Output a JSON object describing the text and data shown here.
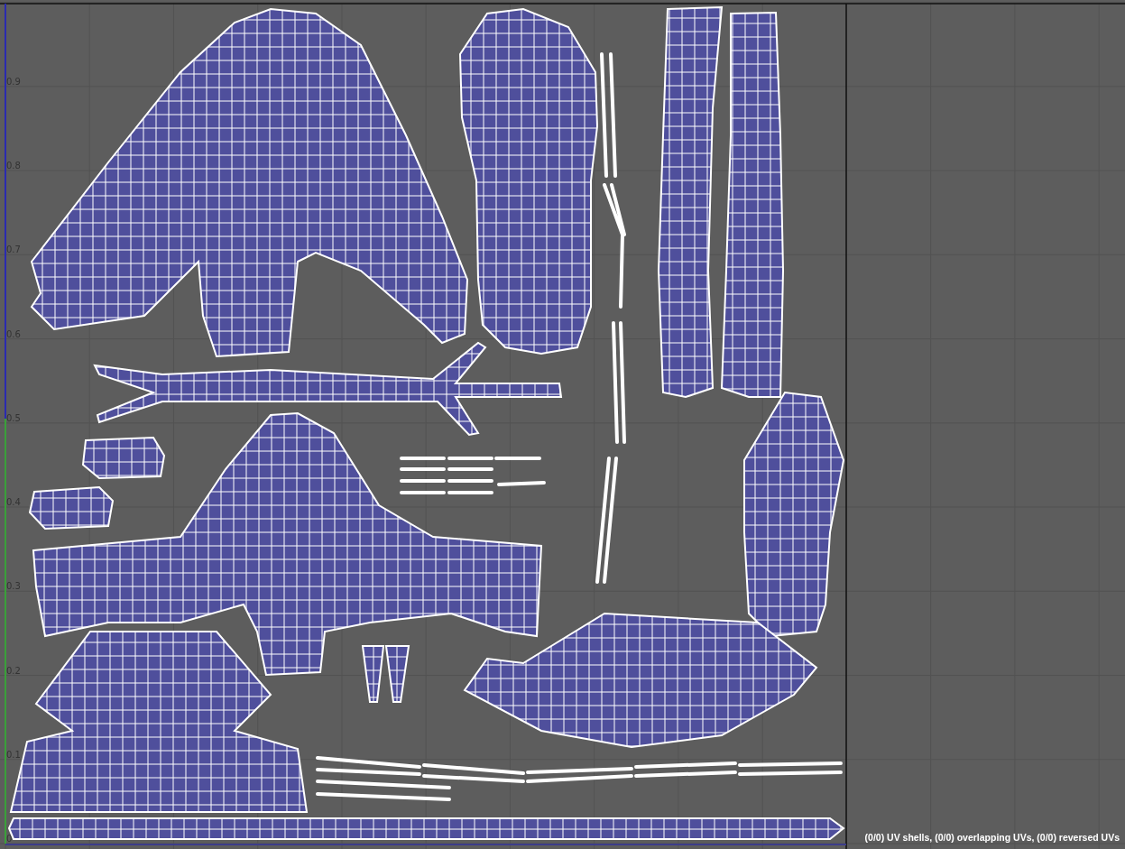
{
  "v_axis_labels": [
    "0.9",
    "0.8",
    "0.7",
    "0.6",
    "0.5",
    "0.4",
    "0.3",
    "0.2",
    "0.1",
    "0"
  ],
  "status_bar": {
    "text": "(0/0) UV shells, (0/0) overlapping UVs, (0/0) reversed UVs"
  }
}
